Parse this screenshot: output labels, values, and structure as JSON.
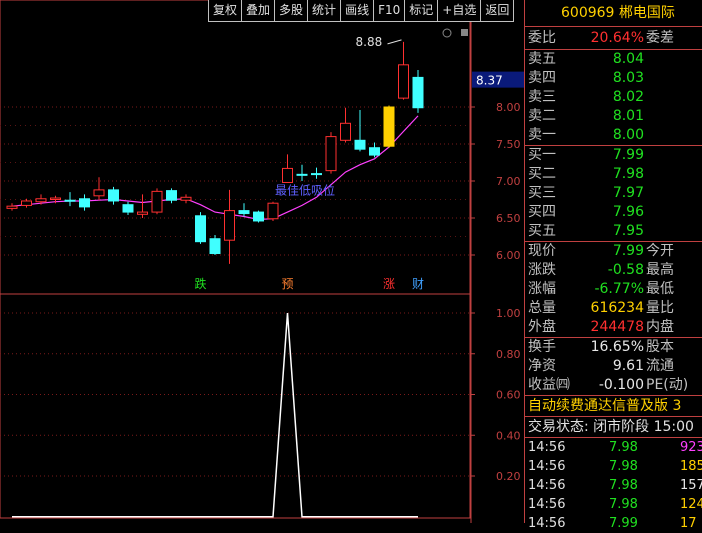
{
  "toolbar": [
    "复权",
    "叠加",
    "多股",
    "统计",
    "画线",
    "F10",
    "标记",
    "+自选",
    "返回"
  ],
  "stock": {
    "code": "600969",
    "name": "郴电国际"
  },
  "weibi": {
    "label": "委比",
    "value": "20.64%",
    "label2": "委差"
  },
  "sell": [
    {
      "label": "卖五",
      "price": "8.04"
    },
    {
      "label": "卖四",
      "price": "8.03"
    },
    {
      "label": "卖三",
      "price": "8.02"
    },
    {
      "label": "卖二",
      "price": "8.01"
    },
    {
      "label": "卖一",
      "price": "8.00"
    }
  ],
  "buy": [
    {
      "label": "买一",
      "price": "7.99"
    },
    {
      "label": "买二",
      "price": "7.98"
    },
    {
      "label": "买三",
      "price": "7.97"
    },
    {
      "label": "买四",
      "price": "7.96"
    },
    {
      "label": "买五",
      "price": "7.95"
    }
  ],
  "quote": [
    {
      "label": "现价",
      "value": "7.99",
      "label2": "今开",
      "color": "#20e020"
    },
    {
      "label": "涨跌",
      "value": "-0.58",
      "label2": "最高",
      "color": "#20e020"
    },
    {
      "label": "涨幅",
      "value": "-6.77%",
      "label2": "最低",
      "color": "#20e020"
    },
    {
      "label": "总量",
      "value": "616234",
      "label2": "量比",
      "color": "#ffd000"
    },
    {
      "label": "外盘",
      "value": "244478",
      "label2": "内盘",
      "color": "#ff3030"
    }
  ],
  "extra": [
    {
      "label": "换手",
      "value": "16.65%",
      "label2": "股本"
    },
    {
      "label": "净资",
      "value": "9.61",
      "label2": "流通"
    },
    {
      "label": "收益㈣",
      "value": "-0.100",
      "label2": "PE(动)"
    }
  ],
  "marquee": "自动续费通达信普及版 3",
  "trade_state": "交易状态: 闭市阶段 15:00",
  "ticks": [
    {
      "time": "14:56",
      "price": "7.98",
      "vol": "923",
      "vcolor": "#ff40ff"
    },
    {
      "time": "14:56",
      "price": "7.98",
      "vol": "185",
      "vcolor": "#ffd000"
    },
    {
      "time": "14:56",
      "price": "7.98",
      "vol": "157",
      "vcolor": "#e8e8e8"
    },
    {
      "time": "14:56",
      "price": "7.98",
      "vol": "124",
      "vcolor": "#ffd000"
    },
    {
      "time": "14:56",
      "price": "7.99",
      "vol": "17",
      "vcolor": "#ffd000"
    }
  ],
  "chart_data": [
    {
      "type": "candlestick",
      "y_ticks": [
        "8.00",
        "7.50",
        "7.00",
        "6.50",
        "6.00"
      ],
      "ylim": [
        5.9,
        8.95
      ],
      "current_price_label": "8.37",
      "high_label": "8.88",
      "annotation": "最佳低吸位",
      "markers": [
        {
          "text": "跌",
          "index": 13,
          "color": "#20e020"
        },
        {
          "text": "预",
          "index": 19,
          "color": "#ff8030"
        },
        {
          "text": "涨",
          "index": 26,
          "color": "#ff3030"
        },
        {
          "text": "财",
          "index": 28,
          "color": "#40a0ff"
        }
      ],
      "candles": [
        {
          "o": 6.63,
          "c": 6.66,
          "h": 6.7,
          "l": 6.6
        },
        {
          "o": 6.67,
          "c": 6.73,
          "h": 6.76,
          "l": 6.64
        },
        {
          "o": 6.72,
          "c": 6.76,
          "h": 6.82,
          "l": 6.68
        },
        {
          "o": 6.75,
          "c": 6.77,
          "h": 6.8,
          "l": 6.7
        },
        {
          "o": 6.74,
          "c": 6.73,
          "h": 6.85,
          "l": 6.66
        },
        {
          "o": 6.76,
          "c": 6.65,
          "h": 6.82,
          "l": 6.6
        },
        {
          "o": 6.8,
          "c": 6.88,
          "h": 7.05,
          "l": 6.74
        },
        {
          "o": 6.88,
          "c": 6.73,
          "h": 6.92,
          "l": 6.68
        },
        {
          "o": 6.68,
          "c": 6.58,
          "h": 6.72,
          "l": 6.54
        },
        {
          "o": 6.55,
          "c": 6.58,
          "h": 6.82,
          "l": 6.5
        },
        {
          "o": 6.58,
          "c": 6.86,
          "h": 6.9,
          "l": 6.55
        },
        {
          "o": 6.87,
          "c": 6.74,
          "h": 6.9,
          "l": 6.7
        },
        {
          "o": 6.74,
          "c": 6.78,
          "h": 6.82,
          "l": 6.7
        },
        {
          "o": 6.53,
          "c": 6.18,
          "h": 6.58,
          "l": 6.15
        },
        {
          "o": 6.22,
          "c": 6.02,
          "h": 6.27,
          "l": 6.0
        },
        {
          "o": 6.2,
          "c": 6.6,
          "h": 6.88,
          "l": 5.88
        },
        {
          "o": 6.6,
          "c": 6.56,
          "h": 6.7,
          "l": 6.52
        },
        {
          "o": 6.58,
          "c": 6.46,
          "h": 6.6,
          "l": 6.44
        },
        {
          "o": 6.49,
          "c": 6.7,
          "h": 6.72,
          "l": 6.46
        },
        {
          "o": 6.98,
          "c": 7.17,
          "h": 7.36,
          "l": 6.98
        },
        {
          "o": 7.09,
          "c": 7.08,
          "h": 7.22,
          "l": 7.0
        },
        {
          "o": 7.1,
          "c": 7.09,
          "h": 7.18,
          "l": 7.03
        },
        {
          "o": 7.14,
          "c": 7.6,
          "h": 7.66,
          "l": 7.1
        },
        {
          "o": 7.55,
          "c": 7.78,
          "h": 7.99,
          "l": 7.52
        },
        {
          "o": 7.55,
          "c": 7.43,
          "h": 7.96,
          "l": 7.4
        },
        {
          "o": 7.45,
          "c": 7.35,
          "h": 7.52,
          "l": 7.32
        },
        {
          "o": 7.47,
          "c": 8.0,
          "h": 8.02,
          "l": 7.45
        },
        {
          "o": 8.12,
          "c": 8.57,
          "h": 8.88,
          "l": 8.1
        },
        {
          "o": 8.4,
          "c": 7.99,
          "h": 8.5,
          "l": 7.92
        }
      ],
      "ma": [
        6.66,
        6.68,
        6.7,
        6.72,
        6.73,
        6.73,
        6.74,
        6.75,
        6.73,
        6.71,
        6.73,
        6.75,
        6.76,
        6.68,
        6.58,
        6.55,
        6.52,
        6.48,
        6.49,
        6.58,
        6.67,
        6.78,
        6.95,
        7.12,
        7.22,
        7.3,
        7.46,
        7.67,
        7.88
      ]
    },
    {
      "type": "line",
      "y_ticks": [
        "1.00",
        "0.80",
        "0.60",
        "0.40",
        "0.20"
      ],
      "ylim": [
        0,
        1.0
      ],
      "values": [
        0,
        0,
        0,
        0,
        0,
        0,
        0,
        0,
        0,
        0,
        0,
        0,
        0,
        0,
        0,
        0,
        0,
        0,
        0,
        1,
        0,
        0,
        0,
        0,
        0,
        0,
        0,
        0,
        0
      ]
    }
  ]
}
